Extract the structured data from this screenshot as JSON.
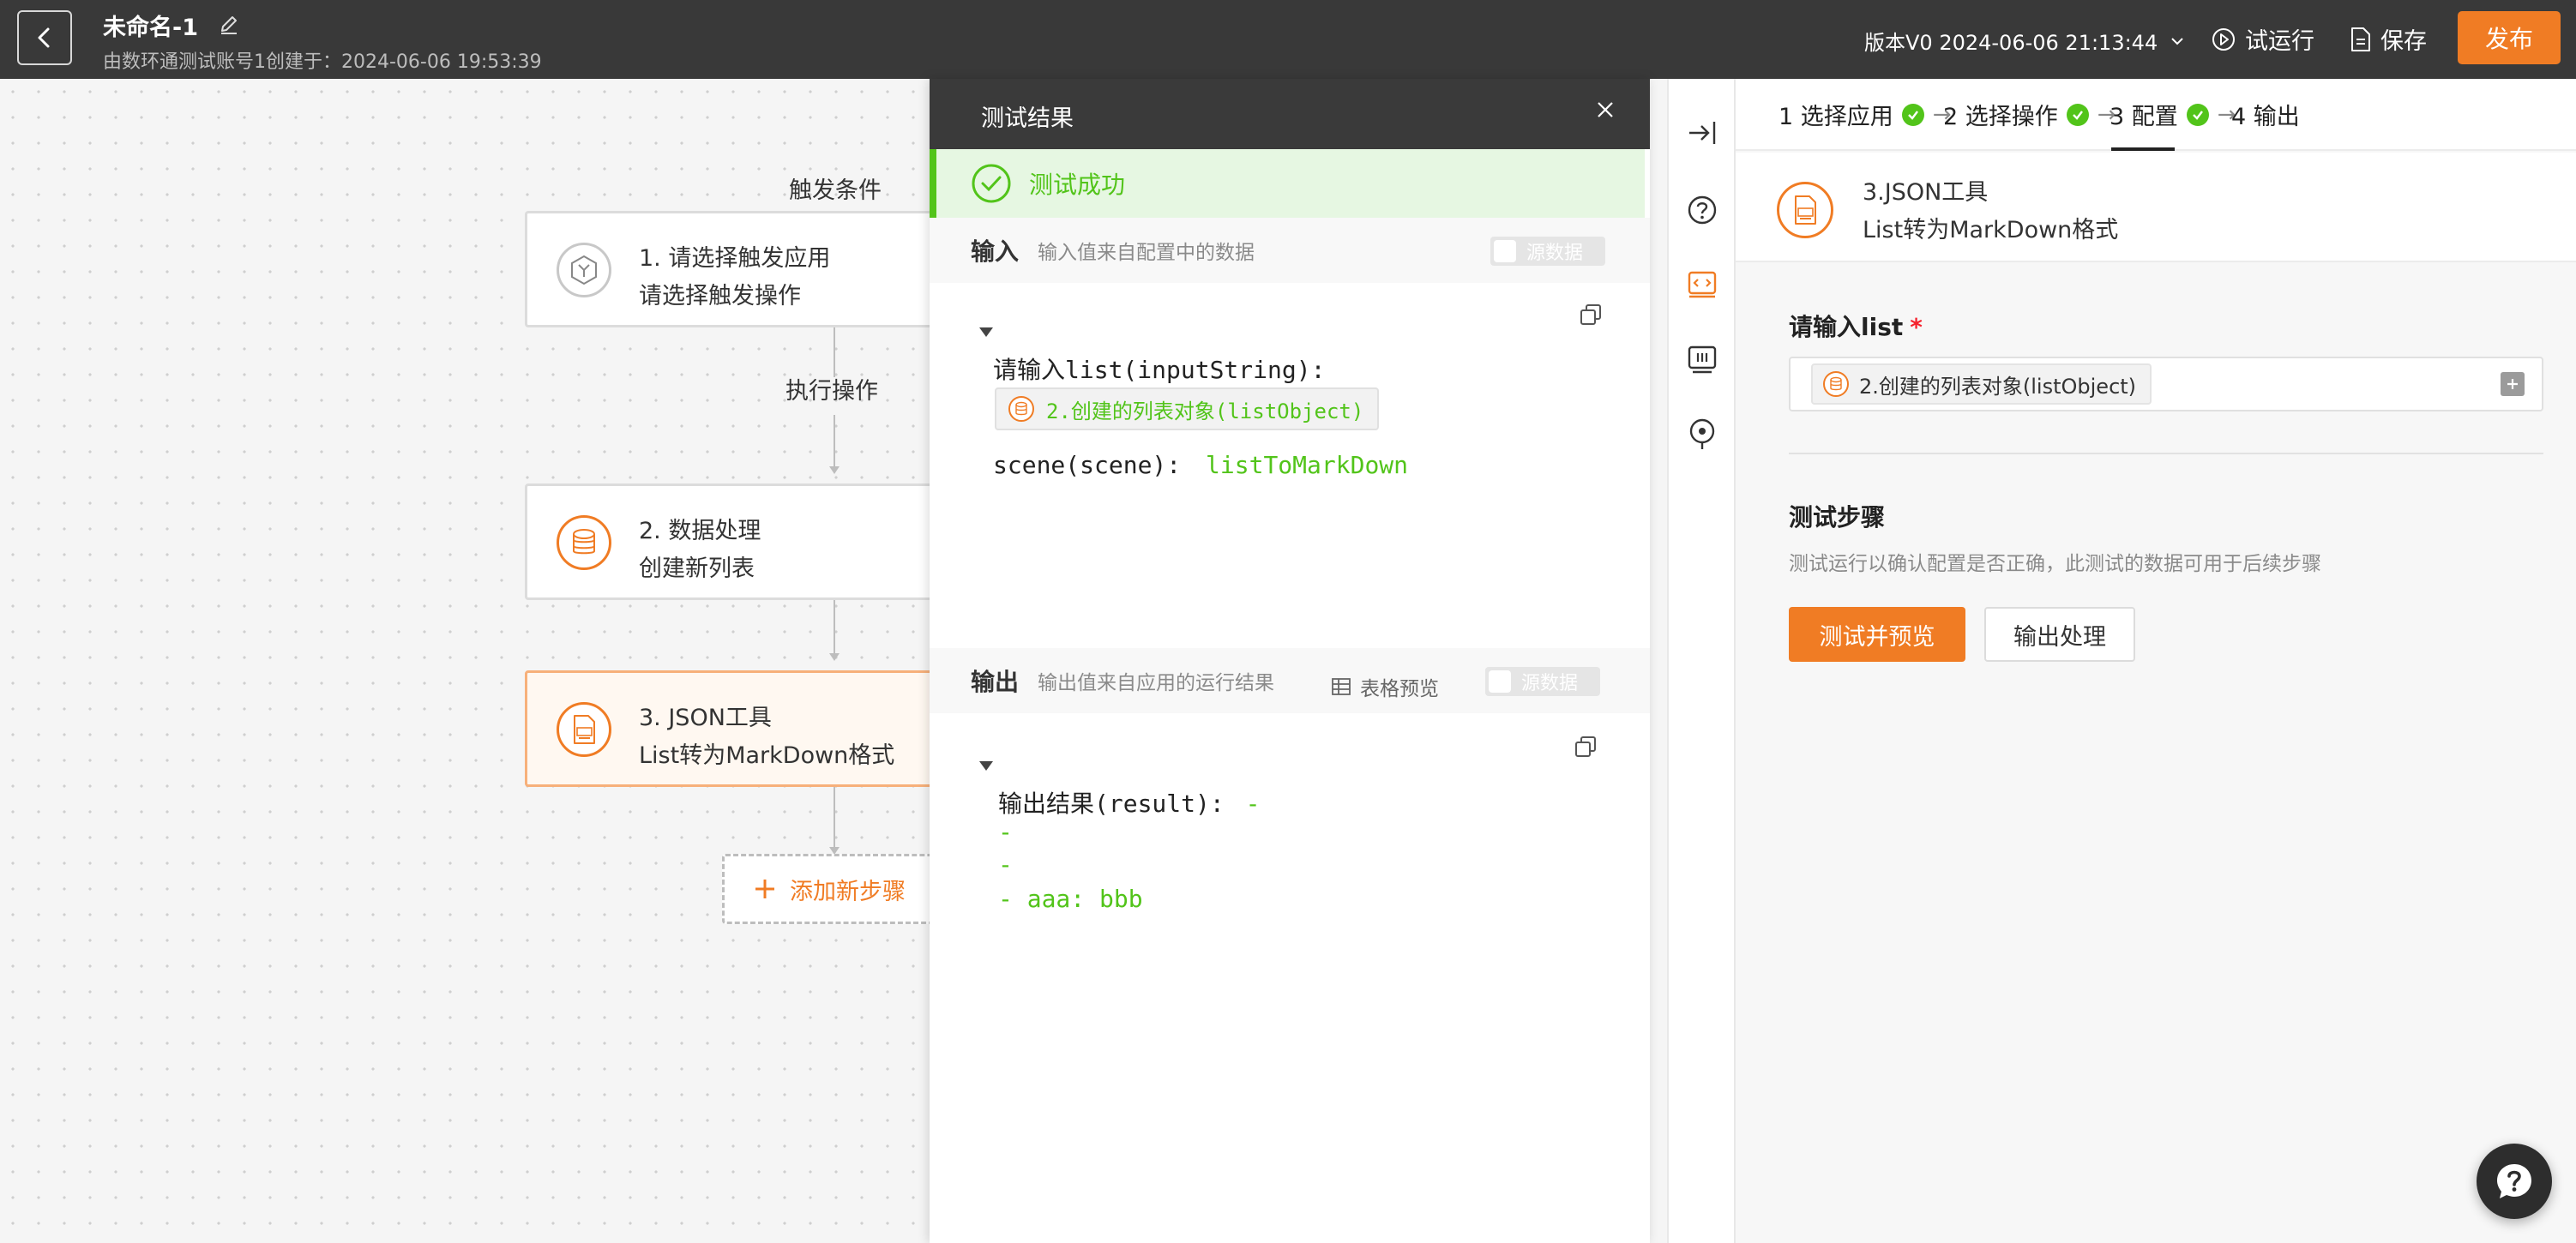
{
  "header": {
    "title": "未命名-1",
    "subtitle": "由数环通测试账号1创建于：2024-06-06 19:53:39",
    "version": "版本V0 2024-06-06 21:13:44",
    "trial_run": "试运行",
    "save": "保存",
    "publish": "发布"
  },
  "flow": {
    "trigger_label": "触发条件",
    "action_label": "执行操作",
    "nodes": [
      {
        "line1": "1. 请选择触发应用",
        "line2": "请选择触发操作",
        "icon": "hexagon-icon"
      },
      {
        "line1": "2. 数据处理",
        "line2": "创建新列表",
        "icon": "database-icon"
      },
      {
        "line1": "3. JSON工具",
        "line2": "List转为MarkDown格式",
        "icon": "json-file-icon"
      }
    ],
    "add_step": "添加新步骤"
  },
  "result_panel": {
    "title": "测试结果",
    "success": "测试成功",
    "input": {
      "title": "输入",
      "subtitle": "输入值来自配置中的数据",
      "toggle_label": "源数据",
      "field1_key": "请输入list(inputString):",
      "field1_ref": "2.创建的列表对象(listObject)",
      "field2_key": "scene(scene):",
      "field2_value": "listToMarkDown"
    },
    "output": {
      "title": "输出",
      "subtitle": "输出值来自应用的运行结果",
      "table_preview": "表格预览",
      "toggle_label": "源数据",
      "result_key": "输出结果(result):",
      "result_first": "-",
      "result_lines": [
        "-",
        "-",
        "- aaa: bbb"
      ]
    }
  },
  "config": {
    "steps": [
      {
        "label": "1 选择应用",
        "done": true
      },
      {
        "label": "2 选择操作",
        "done": true
      },
      {
        "label": "3 配置",
        "done": true
      },
      {
        "label": "4 输出",
        "done": false
      }
    ],
    "step_arrow": "→",
    "node_title": "3.JSON工具",
    "node_subtitle": "List转为MarkDown格式",
    "field_label": "请输入list",
    "required_mark": "*",
    "field_chip": "2.创建的列表对象(listObject)",
    "test_title": "测试步骤",
    "test_desc": "测试运行以确认配置是否正确，此测试的数据可用于后续步骤",
    "btn_test": "测试并预览",
    "btn_output": "输出处理"
  },
  "colors": {
    "accent": "#f07c24",
    "success": "#52c41a",
    "topbar": "#393939"
  }
}
